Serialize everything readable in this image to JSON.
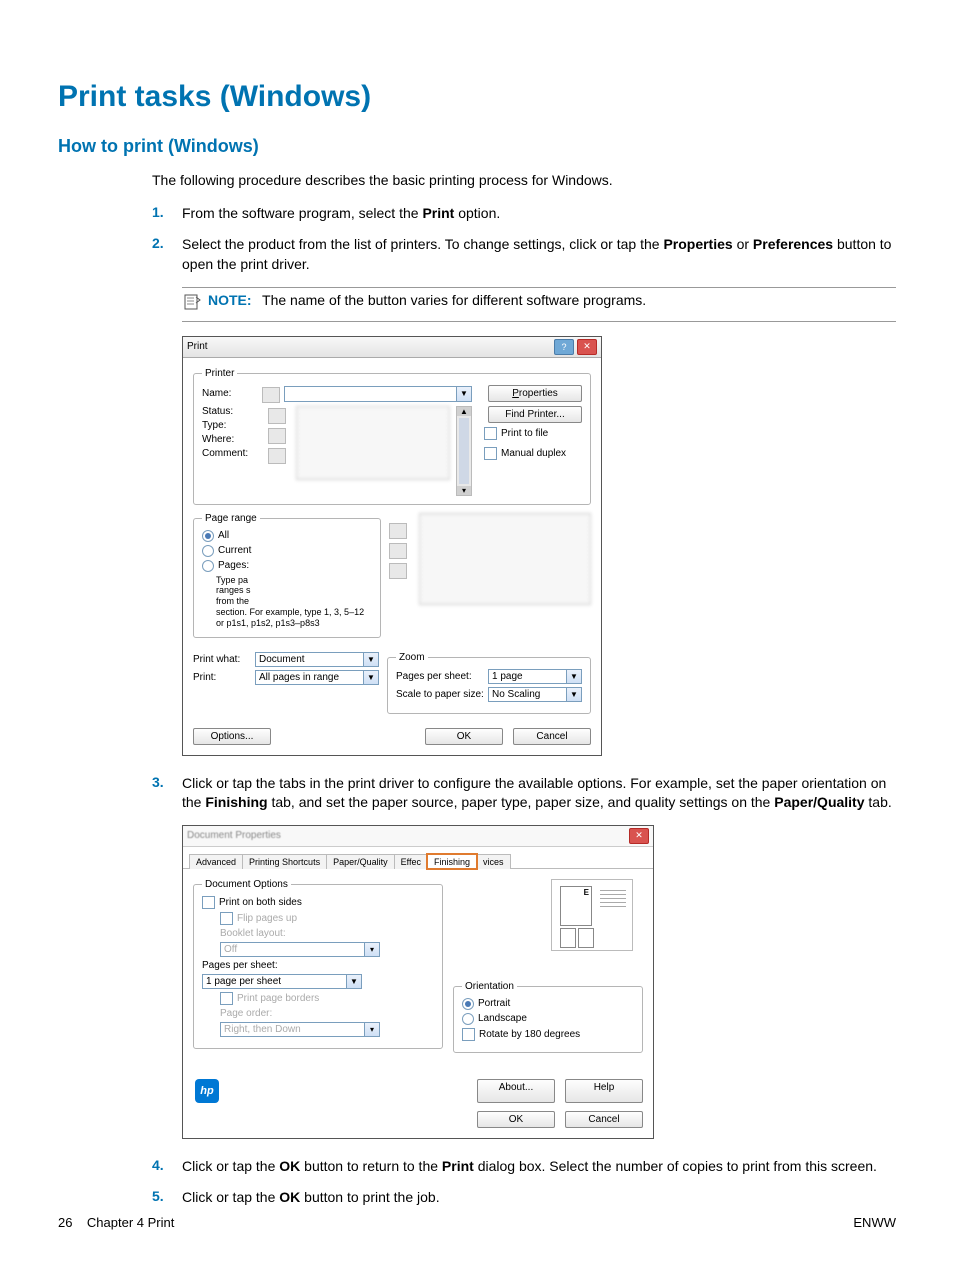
{
  "headings": {
    "title": "Print tasks (Windows)",
    "subtitle": "How to print (Windows)"
  },
  "intro": "The following procedure describes the basic printing process for Windows.",
  "steps": {
    "s1": {
      "num": "1.",
      "pre": "From the software program, select the ",
      "bold1": "Print",
      "post": " option."
    },
    "s2": {
      "num": "2.",
      "a": "Select the product from the list of printers. To change settings, click or tap the ",
      "b1": "Properties",
      "b": " or ",
      "b2": "Preferences",
      "c": " button to open the print driver."
    },
    "s3": {
      "num": "3.",
      "a": "Click or tap the tabs in the print driver to configure the available options. For example, set the paper orientation on the ",
      "b1": "Finishing",
      "b": " tab, and set the paper source, paper type, paper size, and quality settings on the ",
      "b2": "Paper/Quality",
      "c": " tab."
    },
    "s4": {
      "num": "4.",
      "a": "Click or tap the ",
      "b1": "OK",
      "b": " button to return to the ",
      "b2": "Print",
      "c": " dialog box. Select the number of copies to print from this screen."
    },
    "s5": {
      "num": "5.",
      "a": "Click or tap the ",
      "b1": "OK",
      "b": " button to print the job."
    }
  },
  "note": {
    "label": "NOTE:",
    "text": "The name of the button varies for different software programs."
  },
  "printDialog": {
    "title": "Print",
    "printerLegend": "Printer",
    "nameLabel": "Name:",
    "statusLabel": "Status:",
    "typeLabel": "Type:",
    "whereLabel": "Where:",
    "commentLabel": "Comment:",
    "propertiesBtn": "Properties",
    "findPrinterBtn": "Find Printer...",
    "printToFile": "Print to file",
    "manualDuplex": "Manual duplex",
    "pageRangeLegend": "Page range",
    "all": "All",
    "current": "Current",
    "pages": "Pages:",
    "typePageHint1": "Type pa",
    "typePageHint2": "ranges s",
    "typePageHint3": "from the",
    "typePageHint4": "section. For example, type 1, 3, 5–12",
    "typePageHint5": "or p1s1, p1s2, p1s3–p8s3",
    "printWhatLabel": "Print what:",
    "printWhatValue": "Document",
    "printLabel": "Print:",
    "printValue": "All pages in range",
    "zoomLegend": "Zoom",
    "pagesPerSheetLabel": "Pages per sheet:",
    "pagesPerSheetValue": "1 page",
    "scaleToPaperLabel": "Scale to paper size:",
    "scaleToPaperValue": "No Scaling",
    "optionsBtn": "Options...",
    "okBtn": "OK",
    "cancelBtn": "Cancel"
  },
  "propsDialog": {
    "title": "Document Properties",
    "tabs": {
      "advanced": "Advanced",
      "shortcuts": "Printing Shortcuts",
      "paper": "Paper/Quality",
      "effects": "Effec",
      "finishing": "Finishing",
      "services": "vices"
    },
    "docOptionsLegend": "Document Options",
    "printBothSides": "Print on both sides",
    "flipPagesUp": "Flip pages up",
    "bookletLayout": "Booklet layout:",
    "bookletOff": "Off",
    "pagesPerSheetLabel": "Pages per sheet:",
    "pagesPerSheetValue": "1 page per sheet",
    "printPageBorders": "Print page borders",
    "pageOrderLabel": "Page order:",
    "pageOrderValue": "Right, then Down",
    "orientationLegend": "Orientation",
    "portrait": "Portrait",
    "landscape": "Landscape",
    "rotate180": "Rotate by 180 degrees",
    "aboutBtn": "About...",
    "helpBtn": "Help",
    "okBtn": "OK",
    "cancelBtn": "Cancel"
  },
  "footer": {
    "left_page": "26",
    "left_text": "Chapter 4   Print",
    "right": "ENWW"
  }
}
